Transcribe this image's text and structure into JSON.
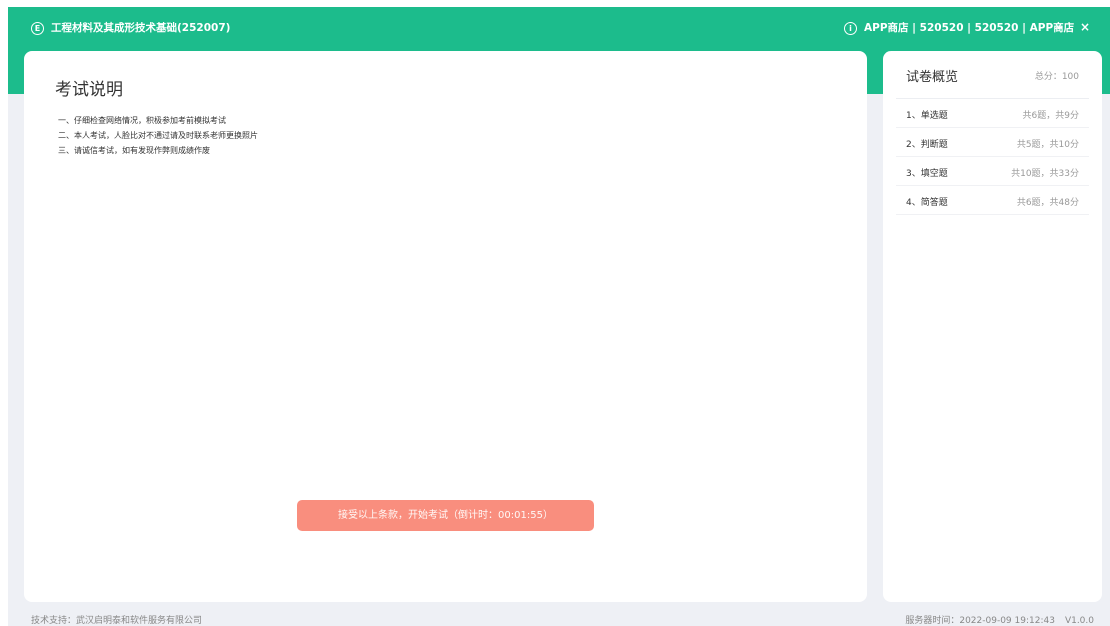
{
  "window": {
    "app_icon": "exam-logo-icon",
    "title": "工程材料及其成形技术基础(252007)",
    "user": "APP商店 | 520520 | 520520 | APP商店",
    "minimize_label": "–",
    "close_label": "×"
  },
  "instructions": {
    "title": "考试说明",
    "items": [
      "一、仔细检查网络情况，积极参加考前模拟考试",
      "二、本人考试，人脸比对不通过请及时联系老师更换照片",
      "三、请诚信考试，如有发现作弊则成绩作废"
    ],
    "start_button": "接受以上条款，开始考试（倒计时：00:01:55）"
  },
  "overview": {
    "title": "试卷概览",
    "total": "总分：100",
    "sections": [
      {
        "name": "1、单选题",
        "info": "共6题，共9分"
      },
      {
        "name": "2、判断题",
        "info": "共5题，共10分"
      },
      {
        "name": "3、填空题",
        "info": "共10题，共33分"
      },
      {
        "name": "4、简答题",
        "info": "共6题，共48分"
      }
    ]
  },
  "footer": {
    "support": "技术支持：武汉启明泰和软件服务有限公司",
    "server_time": "服务器时间：2022-09-09 19:12:43",
    "version": "V1.0.0"
  },
  "colors": {
    "header": "#1cbc8c",
    "start_button": "#f98e7e",
    "background": "#eef0f5"
  }
}
